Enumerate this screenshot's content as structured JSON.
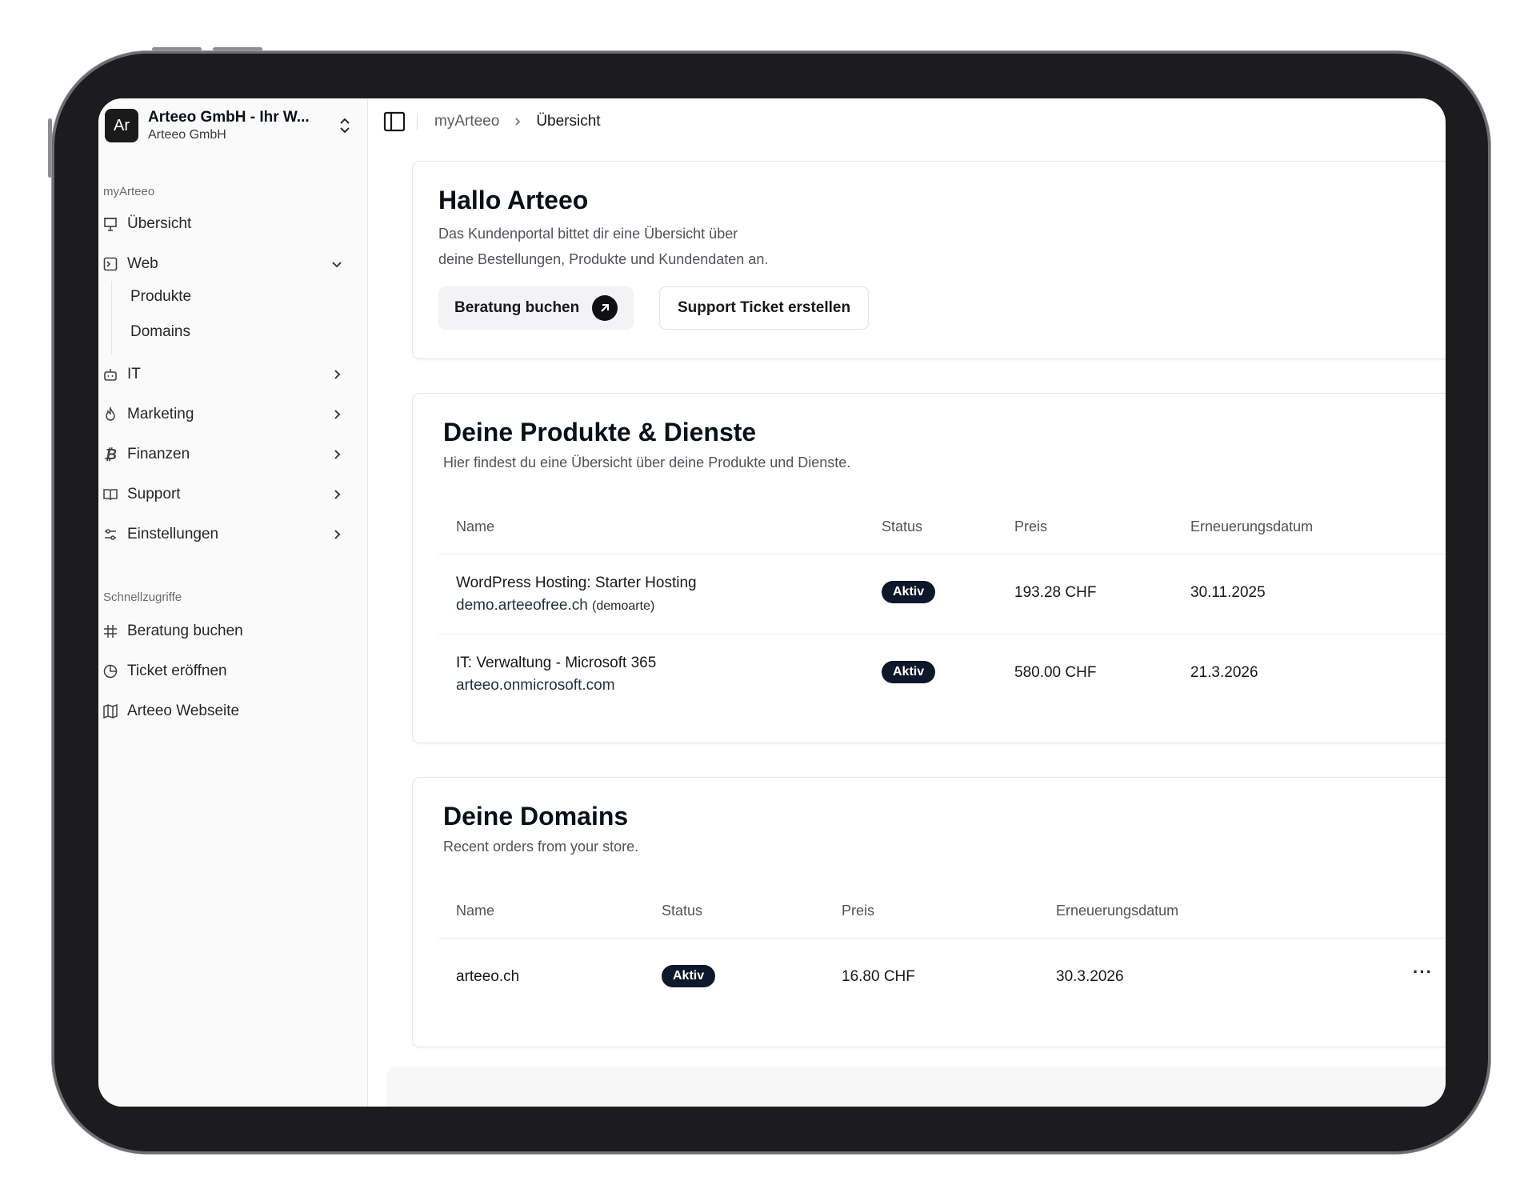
{
  "brand": {
    "avatar": "Ar",
    "title": "Arteeo GmbH - Ihr W...",
    "subtitle": "Arteeo GmbH"
  },
  "sidebar": {
    "group_label": "myArteeo",
    "items": [
      {
        "label": "Übersicht",
        "icon": "presentation-icon"
      },
      {
        "label": "Web",
        "icon": "terminal-icon",
        "expanded": true,
        "children": [
          "Produkte",
          "Domains"
        ]
      },
      {
        "label": "IT",
        "icon": "bot-icon"
      },
      {
        "label": "Marketing",
        "icon": "flame-icon"
      },
      {
        "label": "Finanzen",
        "icon": "bitcoin-icon"
      },
      {
        "label": "Support",
        "icon": "book-open-icon"
      },
      {
        "label": "Einstellungen",
        "icon": "settings-sliders-icon"
      }
    ],
    "quick_label": "Schnellzugriffe",
    "quick": [
      {
        "label": "Beratung buchen",
        "icon": "hash-icon"
      },
      {
        "label": "Ticket eröffnen",
        "icon": "pie-chart-icon"
      },
      {
        "label": "Arteeo Webseite",
        "icon": "map-icon"
      }
    ]
  },
  "breadcrumb": {
    "root": "myArteeo",
    "current": "Übersicht"
  },
  "welcome": {
    "title": "Hallo Arteeo",
    "desc_line1": "Das Kundenportal bittet dir eine Übersicht über",
    "desc_line2": "deine Bestellungen, Produkte und Kundendaten an.",
    "btn_primary": "Beratung buchen",
    "btn_secondary": "Support Ticket erstellen"
  },
  "products": {
    "title": "Deine Produkte & Dienste",
    "desc": "Hier findest du eine Übersicht über deine Produkte und Dienste.",
    "columns": [
      "Name",
      "Status",
      "Preis",
      "Erneuerungsdatum"
    ],
    "rows": [
      {
        "name": "WordPress Hosting: Starter Hosting",
        "sub": "demo.arteeofree.ch",
        "sub_note": "(demoarte)",
        "status": "Aktiv",
        "price": "193.28 CHF",
        "renewal": "30.11.2025"
      },
      {
        "name": "IT: Verwaltung - Microsoft 365",
        "sub": "arteeo.onmicrosoft.com",
        "sub_note": "",
        "status": "Aktiv",
        "price": "580.00 CHF",
        "renewal": "21.3.2026"
      }
    ]
  },
  "domains": {
    "title": "Deine Domains",
    "desc": "Recent orders from your store.",
    "columns": [
      "Name",
      "Status",
      "Preis",
      "Erneuerungsdatum"
    ],
    "rows": [
      {
        "name": "arteeo.ch",
        "status": "Aktiv",
        "price": "16.80 CHF",
        "renewal": "30.3.2026",
        "more": "···"
      }
    ]
  }
}
